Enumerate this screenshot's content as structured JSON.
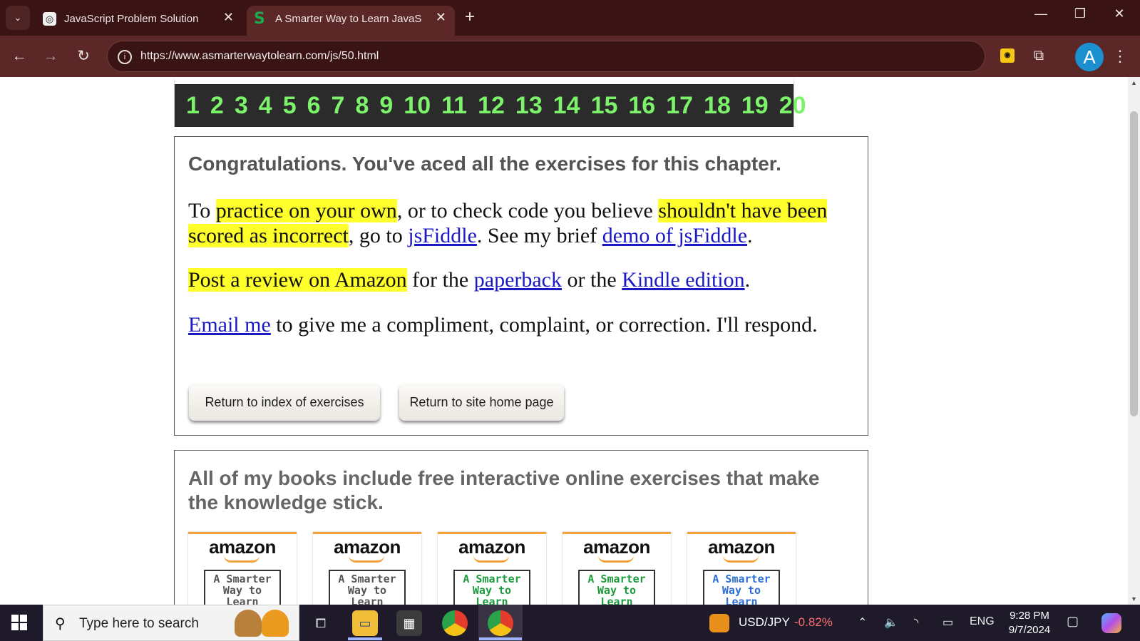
{
  "browser": {
    "tabs": [
      {
        "title": "JavaScript Problem Solution",
        "favicon": "chatgpt-icon",
        "active": false
      },
      {
        "title": "A Smarter Way to Learn JavaScri",
        "favicon": "s-logo-icon",
        "active": true
      }
    ],
    "favicon_s": "S",
    "tab_list_glyph": "⌄",
    "close_glyph": "✕",
    "newtab_glyph": "+",
    "url": "https://www.asmarterwaytolearn.com/js/50.html",
    "avatar_initial": "A",
    "window_controls": {
      "minimize": "—",
      "restore": "❐",
      "close": "✕"
    },
    "nav": {
      "back": "←",
      "forward": "→",
      "reload": "↻"
    },
    "menu_glyph": "⋮"
  },
  "chapter_nav": {
    "numbers": [
      "1",
      "2",
      "3",
      "4",
      "5",
      "6",
      "7",
      "8",
      "9",
      "10",
      "11",
      "12",
      "13",
      "14",
      "15",
      "16",
      "17",
      "18",
      "19",
      "20"
    ],
    "color": "#7cf36a"
  },
  "congrats": {
    "heading": "Congratulations. You've aced all the exercises for this chapter.",
    "p1": {
      "hl1": "practice on your own",
      "t1": "To ",
      "t2": ", or to check code you believe ",
      "hl2": "shouldn't have been scored as incorrect",
      "t3": ", go to ",
      "link1": "jsFiddle",
      "t4": ". See my brief ",
      "link2": "demo of jsFiddle",
      "t5": "."
    },
    "p2": {
      "hl": "Post a review on Amazon",
      "t1": " for the ",
      "link1": "paperback",
      "t2": " or the ",
      "link2": "Kindle edition",
      "t3": "."
    },
    "p3": {
      "link": "Email me",
      "text": " to give me a compliment, complaint, or correction. I'll respond."
    },
    "buttons": {
      "index": "Return to index of exercises",
      "home": "Return to site home page"
    }
  },
  "books": {
    "heading": "All of my books include free interactive online exercises that make the knowledge stick.",
    "covers": [
      {
        "logo": "amazon",
        "title": "A Smarter Way to Learn"
      },
      {
        "logo": "amazon",
        "title": "A Smarter Way to Learn"
      },
      {
        "logo": "amazon",
        "title": "A Smarter Way to Learn"
      },
      {
        "logo": "amazon",
        "title": "A Smarter Way to Learn"
      },
      {
        "logo": "amazon",
        "title": "A Smarter Way to Learn"
      }
    ]
  },
  "taskbar": {
    "search_placeholder": "Type here to search",
    "ticker_symbol": "USD/JPY",
    "ticker_change": "-0.82%",
    "language": "ENG",
    "time": "9:28 PM",
    "date": "9/7/2024"
  },
  "colors": {
    "tabbar": "#3a1414",
    "toolbar": "#5b2727",
    "highlight": "#ffff2b",
    "link": "#1a19c4",
    "amazon_orange": "#f3a13a"
  }
}
